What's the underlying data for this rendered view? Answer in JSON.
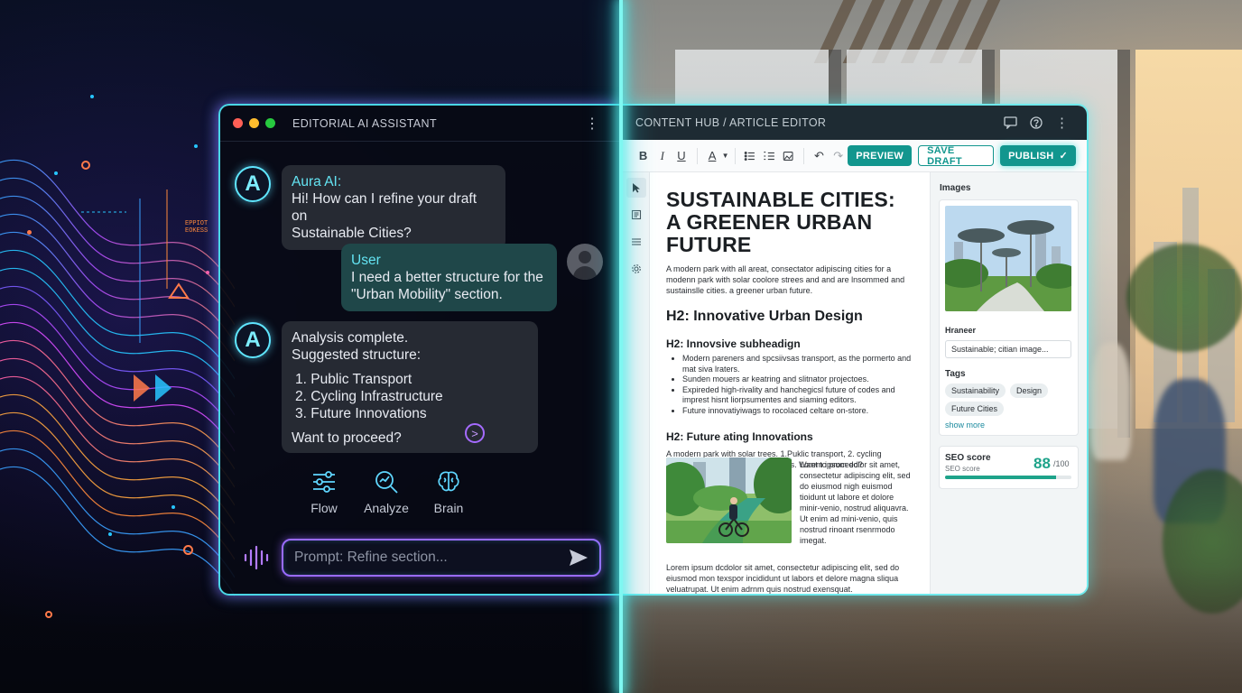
{
  "ai_assistant": {
    "window_title": "EDITORIAL AI ASSISTANT",
    "messages": [
      {
        "avatar": "A",
        "sender": "Aura AI:",
        "lines": [
          "Hi! How can I refine your draft on",
          "Sustainable Cities?"
        ]
      },
      {
        "sender": "User",
        "lines": [
          "I need a better structure for the",
          "\"Urban Mobility\" section."
        ]
      },
      {
        "avatar": "A",
        "lines": [
          "Analysis complete.",
          "Suggested structure:"
        ],
        "steps": [
          "1. Public Transport",
          "2. Cycling Infrastructure",
          "3. Future Innovations"
        ],
        "question": "Want to proceed?"
      }
    ],
    "tools": [
      {
        "label": "Flow",
        "icon": "sliders-icon"
      },
      {
        "label": "Analyze",
        "icon": "magnifier-chart-icon"
      },
      {
        "label": "Brain",
        "icon": "brain-icon"
      }
    ],
    "prompt": {
      "placeholder": "Prompt: Refine section..."
    }
  },
  "editor": {
    "window_title": "CONTENT HUB / ARTICLE EDITOR",
    "toolbar": {
      "bold": "B",
      "italic": "I",
      "underline": "U",
      "text_color": "A",
      "preview": "PREVIEW",
      "save_draft": "SAVE DRAFT",
      "publish": "PUBLISH"
    },
    "article": {
      "title_line1": "SUSTAINABLE CITIES:",
      "title_line2": "A GREENER URBAN FUTURE",
      "intro": "A modern park with all areat, consectator adipiscing cities for a modenn park with solar coolore strees and and are lnsommed and sustainslle cities. a greener urban future.",
      "h2": "H2: Innovative Urban Design",
      "sub1": "H2: Innovsive subheadign",
      "bullets": [
        "Modern pareners and spcsiivsas transport, as the pormerto and mat siva lraters.",
        "Sunden mouers ar keatring and slitnator projectoes.",
        "Expireded high-rivality and hanchegicsl future of codes and imprest hisnt liorpsumentes and siaming editors.",
        "Future innovatiyiwags to rocolaced celtare on-store."
      ],
      "sub2": "H2: Future ating Innovations",
      "para2": "A modern park with solar trees. 1.Puklic transport, 2. cycling infrastructure, 3. Future Innovations. Want to proceed?",
      "image_caption": "Lorem ipsum dolor sit amet, consectetur adipiscing elit, sed do eiusmod nigh euismod tioidunt ut labore et dolore minir-venio, nostrud aliquavra. Ut enim ad mini-venio, quis nostrud rinoant rsenrmodo imegat.",
      "para3": "Lorem ipsum dcdolor sit amet, consectetur adipiscing elit, sed do eiusmod mon texspor incididunt ut labors et delore magna sliqua veluatrupat. Ut enim adrnm quis nostrud exensquat."
    },
    "sidebar": {
      "images_label": "Images",
      "alt_label": "Hraneer",
      "alt_value": "Sustainable; citian image...",
      "tags_label": "Tags",
      "tags": [
        "Sustainability",
        "Design",
        "Future Cities"
      ],
      "show_more": "show more",
      "seo_title": "SEO score",
      "seo_subtitle": "SEO score",
      "seo_value": "88",
      "seo_max": "/100",
      "seo_fraction": 0.88
    }
  },
  "decor": {
    "left_label_1": "EPPIOT",
    "left_label_2": "EOKESS"
  },
  "colors": {
    "accent_cyan": "#4ad7e6",
    "accent_purple": "#9a6bff",
    "editor_teal": "#12968e",
    "seo_green": "#1ea38a"
  }
}
